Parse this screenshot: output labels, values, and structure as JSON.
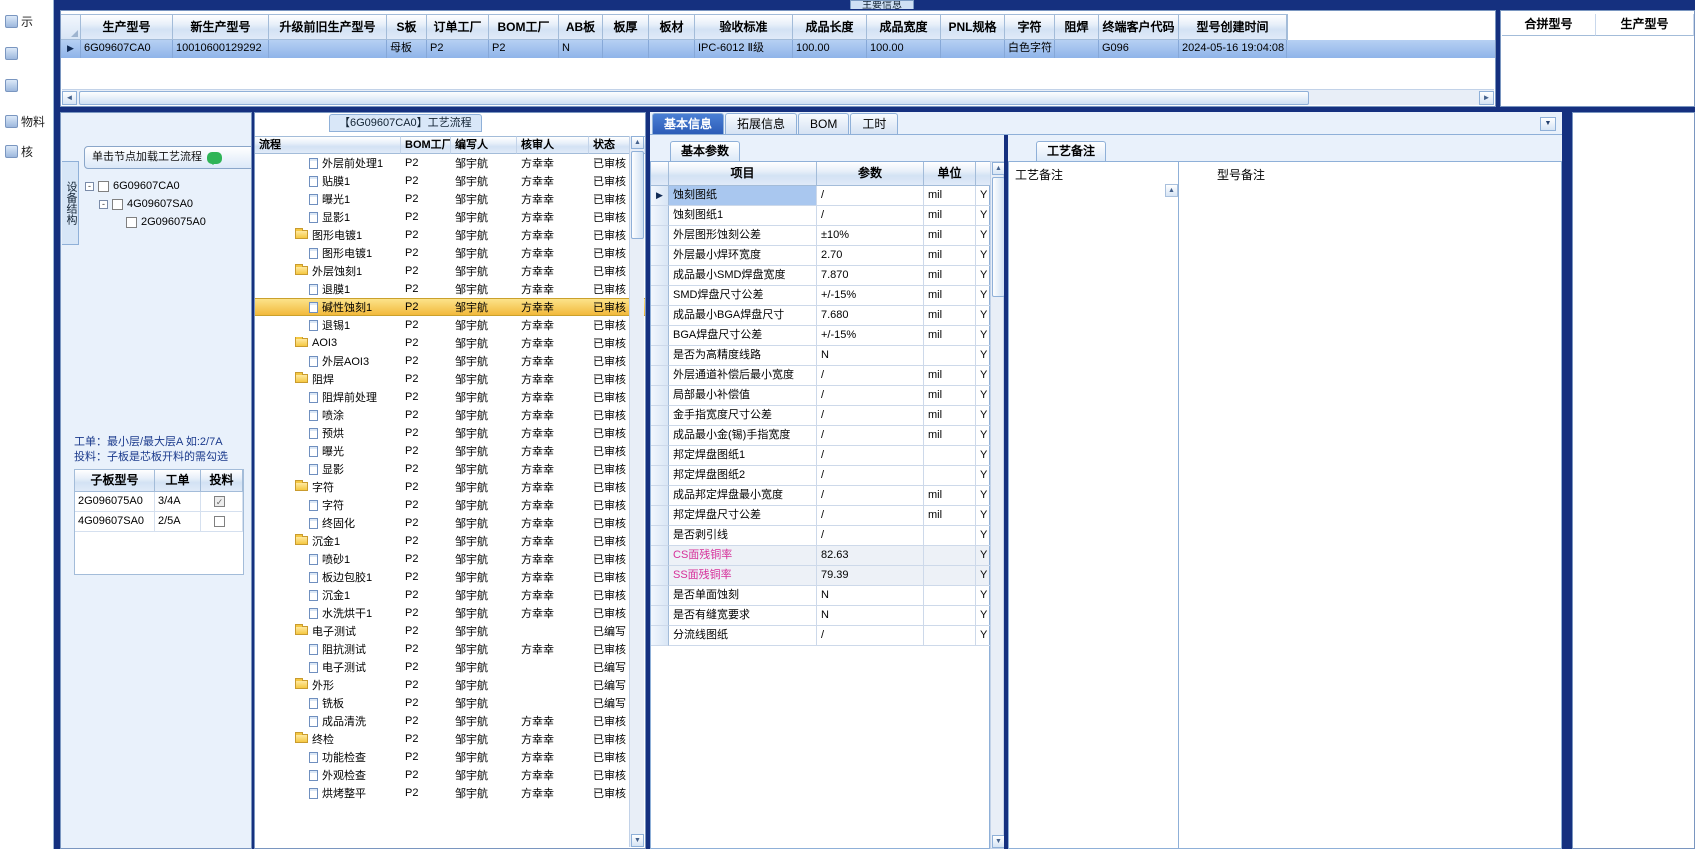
{
  "window": {
    "top_tab": "主要信息",
    "left_nav": [
      {
        "label": "示",
        "icon": "display-icon"
      },
      {
        "label": "",
        "icon": "order-icon"
      },
      {
        "label": "",
        "icon": "board-icon"
      },
      {
        "label": "物料",
        "icon": "material-icon"
      },
      {
        "label": "核",
        "icon": "audit-icon"
      }
    ]
  },
  "model_grid": {
    "columns": [
      "生产型号",
      "新生产型号",
      "升级前旧生产型号",
      "S板",
      "订单工厂",
      "BOM工厂",
      "AB板",
      "板厚",
      "板材",
      "验收标准",
      "成品长度",
      "成品宽度",
      "PNL规格",
      "字符",
      "阻焊",
      "终端客户代码",
      "型号创建时间"
    ],
    "row": [
      "6G09607CA0",
      "10010600129292",
      "",
      "母板",
      "P2",
      "P2",
      "N",
      "",
      "",
      "IPC-6012 Ⅱ级",
      "100.00",
      "100.00",
      "",
      "白色字符",
      "",
      "G096",
      "2024-05-16 19:04:08"
    ]
  },
  "merge_grid": {
    "columns": [
      "合拼型号",
      "生产型号"
    ]
  },
  "structure_panel": {
    "vertical_tab": "设备结构",
    "load_button": "单击节点加载工艺流程",
    "tree": [
      {
        "label": "6G09607CA0",
        "indent": 0,
        "expand": true
      },
      {
        "label": "4G09607SA0",
        "indent": 1,
        "expand": true
      },
      {
        "label": "2G096075A0",
        "indent": 2,
        "expand": false
      }
    ],
    "notes": [
      "工单：最小层/最大层A 如:2/7A",
      "投料：子板是芯板开料的需勾选"
    ],
    "subboard_table": {
      "columns": [
        "子板型号",
        "工单",
        "投料"
      ],
      "rows": [
        {
          "model": "2G096075A0",
          "order": "3/4A",
          "checked": true
        },
        {
          "model": "4G09607SA0",
          "order": "2/5A",
          "checked": false
        }
      ]
    }
  },
  "flow_panel": {
    "title": "【6G09607CA0】工艺流程",
    "columns": [
      "流程",
      "BOM工厂",
      "编写人",
      "核审人",
      "状态"
    ],
    "rows": [
      {
        "name": "外层前处理1",
        "type": "doc",
        "bom": "P2",
        "writer": "邹宇航",
        "reviewer": "方幸幸",
        "status": "已审核",
        "highlight": false
      },
      {
        "name": "贴膜1",
        "type": "doc",
        "bom": "P2",
        "writer": "邹宇航",
        "reviewer": "方幸幸",
        "status": "已审核",
        "highlight": false
      },
      {
        "name": "曝光1",
        "type": "doc",
        "bom": "P2",
        "writer": "邹宇航",
        "reviewer": "方幸幸",
        "status": "已审核",
        "highlight": false
      },
      {
        "name": "显影1",
        "type": "doc",
        "bom": "P2",
        "writer": "邹宇航",
        "reviewer": "方幸幸",
        "status": "已审核",
        "highlight": false
      },
      {
        "name": "图形电镀1",
        "type": "folder",
        "bom": "P2",
        "writer": "邹宇航",
        "reviewer": "方幸幸",
        "status": "已审核",
        "highlight": false
      },
      {
        "name": "图形电镀1",
        "type": "doc",
        "bom": "P2",
        "writer": "邹宇航",
        "reviewer": "方幸幸",
        "status": "已审核",
        "highlight": false
      },
      {
        "name": "外层蚀刻1",
        "type": "folder",
        "bom": "P2",
        "writer": "邹宇航",
        "reviewer": "方幸幸",
        "status": "已审核",
        "highlight": false
      },
      {
        "name": "退膜1",
        "type": "doc",
        "bom": "P2",
        "writer": "邹宇航",
        "reviewer": "方幸幸",
        "status": "已审核",
        "highlight": false
      },
      {
        "name": "碱性蚀刻1",
        "type": "doc",
        "bom": "P2",
        "writer": "邹宇航",
        "reviewer": "方幸幸",
        "status": "已审核",
        "highlight": true
      },
      {
        "name": "退锡1",
        "type": "doc",
        "bom": "P2",
        "writer": "邹宇航",
        "reviewer": "方幸幸",
        "status": "已审核",
        "highlight": false
      },
      {
        "name": "AOI3",
        "type": "folder",
        "bom": "P2",
        "writer": "邹宇航",
        "reviewer": "方幸幸",
        "status": "已审核",
        "highlight": false
      },
      {
        "name": "外层AOI3",
        "type": "doc",
        "bom": "P2",
        "writer": "邹宇航",
        "reviewer": "方幸幸",
        "status": "已审核",
        "highlight": false
      },
      {
        "name": "阻焊",
        "type": "folder",
        "bom": "P2",
        "writer": "邹宇航",
        "reviewer": "方幸幸",
        "status": "已审核",
        "highlight": false
      },
      {
        "name": "阻焊前处理",
        "type": "doc",
        "bom": "P2",
        "writer": "邹宇航",
        "reviewer": "方幸幸",
        "status": "已审核",
        "highlight": false
      },
      {
        "name": "喷涂",
        "type": "doc",
        "bom": "P2",
        "writer": "邹宇航",
        "reviewer": "方幸幸",
        "status": "已审核",
        "highlight": false
      },
      {
        "name": "预烘",
        "type": "doc",
        "bom": "P2",
        "writer": "邹宇航",
        "reviewer": "方幸幸",
        "status": "已审核",
        "highlight": false
      },
      {
        "name": "曝光",
        "type": "doc",
        "bom": "P2",
        "writer": "邹宇航",
        "reviewer": "方幸幸",
        "status": "已审核",
        "highlight": false
      },
      {
        "name": "显影",
        "type": "doc",
        "bom": "P2",
        "writer": "邹宇航",
        "reviewer": "方幸幸",
        "status": "已审核",
        "highlight": false
      },
      {
        "name": "字符",
        "type": "folder",
        "bom": "P2",
        "writer": "邹宇航",
        "reviewer": "方幸幸",
        "status": "已审核",
        "highlight": false
      },
      {
        "name": "字符",
        "type": "doc",
        "bom": "P2",
        "writer": "邹宇航",
        "reviewer": "方幸幸",
        "status": "已审核",
        "highlight": false
      },
      {
        "name": "终固化",
        "type": "doc",
        "bom": "P2",
        "writer": "邹宇航",
        "reviewer": "方幸幸",
        "status": "已审核",
        "highlight": false
      },
      {
        "name": "沉金1",
        "type": "folder",
        "bom": "P2",
        "writer": "邹宇航",
        "reviewer": "方幸幸",
        "status": "已审核",
        "highlight": false
      },
      {
        "name": "喷砂1",
        "type": "doc",
        "bom": "P2",
        "writer": "邹宇航",
        "reviewer": "方幸幸",
        "status": "已审核",
        "highlight": false
      },
      {
        "name": "板边包胶1",
        "type": "doc",
        "bom": "P2",
        "writer": "邹宇航",
        "reviewer": "方幸幸",
        "status": "已审核",
        "highlight": false
      },
      {
        "name": "沉金1",
        "type": "doc",
        "bom": "P2",
        "writer": "邹宇航",
        "reviewer": "方幸幸",
        "status": "已审核",
        "highlight": false
      },
      {
        "name": "水洗烘干1",
        "type": "doc",
        "bom": "P2",
        "writer": "邹宇航",
        "reviewer": "方幸幸",
        "status": "已审核",
        "highlight": false
      },
      {
        "name": "电子测试",
        "type": "folder",
        "bom": "P2",
        "writer": "邹宇航",
        "reviewer": "",
        "status": "已编写",
        "highlight": false
      },
      {
        "name": "阻抗测试",
        "type": "doc",
        "bom": "P2",
        "writer": "邹宇航",
        "reviewer": "方幸幸",
        "status": "已审核",
        "highlight": false
      },
      {
        "name": "电子测试",
        "type": "doc",
        "bom": "P2",
        "writer": "邹宇航",
        "reviewer": "",
        "status": "已编写",
        "highlight": false
      },
      {
        "name": "外形",
        "type": "folder",
        "bom": "P2",
        "writer": "邹宇航",
        "reviewer": "",
        "status": "已编写",
        "highlight": false
      },
      {
        "name": "铣板",
        "type": "doc",
        "bom": "P2",
        "writer": "邹宇航",
        "reviewer": "",
        "status": "已编写",
        "highlight": false
      },
      {
        "name": "成品清洗",
        "type": "doc",
        "bom": "P2",
        "writer": "邹宇航",
        "reviewer": "方幸幸",
        "status": "已审核",
        "highlight": false
      },
      {
        "name": "终检",
        "type": "folder",
        "bom": "P2",
        "writer": "邹宇航",
        "reviewer": "方幸幸",
        "status": "已审核",
        "highlight": false
      },
      {
        "name": "功能检查",
        "type": "doc",
        "bom": "P2",
        "writer": "邹宇航",
        "reviewer": "方幸幸",
        "status": "已审核",
        "highlight": false
      },
      {
        "name": "外观检查",
        "type": "doc",
        "bom": "P2",
        "writer": "邹宇航",
        "reviewer": "方幸幸",
        "status": "已审核",
        "highlight": false
      },
      {
        "name": "烘烤整平",
        "type": "doc",
        "bom": "P2",
        "writer": "邹宇航",
        "reviewer": "方幸幸",
        "status": "已审核",
        "highlight": false
      }
    ]
  },
  "right_panel": {
    "tabs": [
      "基本信息",
      "拓展信息",
      "BOM",
      "工时"
    ],
    "active_tab": "基本信息",
    "sub_tab": "基本参数",
    "param_columns": [
      "项目",
      "参数",
      "单位"
    ],
    "params": [
      {
        "item": "蚀刻图纸",
        "value": "/",
        "unit": "mil",
        "flag": "Y",
        "selected": true,
        "pink": false
      },
      {
        "item": "蚀刻图纸1",
        "value": "/",
        "unit": "mil",
        "flag": "Y",
        "selected": false,
        "pink": false
      },
      {
        "item": "外层图形蚀刻公差",
        "value": "±10%",
        "unit": "mil",
        "flag": "Y",
        "selected": false,
        "pink": false
      },
      {
        "item": "外层最小焊环宽度",
        "value": "2.70",
        "unit": "mil",
        "flag": "Y",
        "selected": false,
        "pink": false
      },
      {
        "item": "成品最小SMD焊盘宽度",
        "value": "7.870",
        "unit": "mil",
        "flag": "Y",
        "selected": false,
        "pink": false
      },
      {
        "item": "SMD焊盘尺寸公差",
        "value": "+/-15%",
        "unit": "mil",
        "flag": "Y",
        "selected": false,
        "pink": false
      },
      {
        "item": "成品最小BGA焊盘尺寸",
        "value": "7.680",
        "unit": "mil",
        "flag": "Y",
        "selected": false,
        "pink": false
      },
      {
        "item": "BGA焊盘尺寸公差",
        "value": "+/-15%",
        "unit": "mil",
        "flag": "Y",
        "selected": false,
        "pink": false
      },
      {
        "item": "是否为高精度线路",
        "value": "N",
        "unit": "",
        "flag": "Y",
        "selected": false,
        "pink": false
      },
      {
        "item": "外层通道补偿后最小宽度",
        "value": "/",
        "unit": "mil",
        "flag": "Y",
        "selected": false,
        "pink": false
      },
      {
        "item": "局部最小补偿值",
        "value": "/",
        "unit": "mil",
        "flag": "Y",
        "selected": false,
        "pink": false
      },
      {
        "item": "金手指宽度尺寸公差",
        "value": "/",
        "unit": "mil",
        "flag": "Y",
        "selected": false,
        "pink": false
      },
      {
        "item": "成品最小金(锡)手指宽度",
        "value": "/",
        "unit": "mil",
        "flag": "Y",
        "selected": false,
        "pink": false
      },
      {
        "item": "邦定焊盘图纸1",
        "value": "/",
        "unit": "",
        "flag": "Y",
        "selected": false,
        "pink": false
      },
      {
        "item": "邦定焊盘图纸2",
        "value": "/",
        "unit": "",
        "flag": "Y",
        "selected": false,
        "pink": false
      },
      {
        "item": "成品邦定焊盘最小宽度",
        "value": "/",
        "unit": "mil",
        "flag": "Y",
        "selected": false,
        "pink": false
      },
      {
        "item": "邦定焊盘尺寸公差",
        "value": "/",
        "unit": "mil",
        "flag": "Y",
        "selected": false,
        "pink": false
      },
      {
        "item": "是否剥引线",
        "value": "/",
        "unit": "",
        "flag": "Y",
        "selected": false,
        "pink": false
      },
      {
        "item": "CS面残铜率",
        "value": "82.63",
        "unit": "",
        "flag": "Y",
        "selected": false,
        "pink": true
      },
      {
        "item": "SS面残铜率",
        "value": "79.39",
        "unit": "",
        "flag": "Y",
        "selected": false,
        "pink": true
      },
      {
        "item": "是否单面蚀刻",
        "value": "N",
        "unit": "",
        "flag": "Y",
        "selected": false,
        "pink": false
      },
      {
        "item": "是否有缝宽要求",
        "value": "N",
        "unit": "",
        "flag": "Y",
        "selected": false,
        "pink": false
      },
      {
        "item": "分流线图纸",
        "value": "/",
        "unit": "",
        "flag": "Y",
        "selected": false,
        "pink": false
      }
    ],
    "remarks": {
      "tab": "工艺备注",
      "left_label": "工艺备注",
      "right_label": "型号备注"
    }
  }
}
